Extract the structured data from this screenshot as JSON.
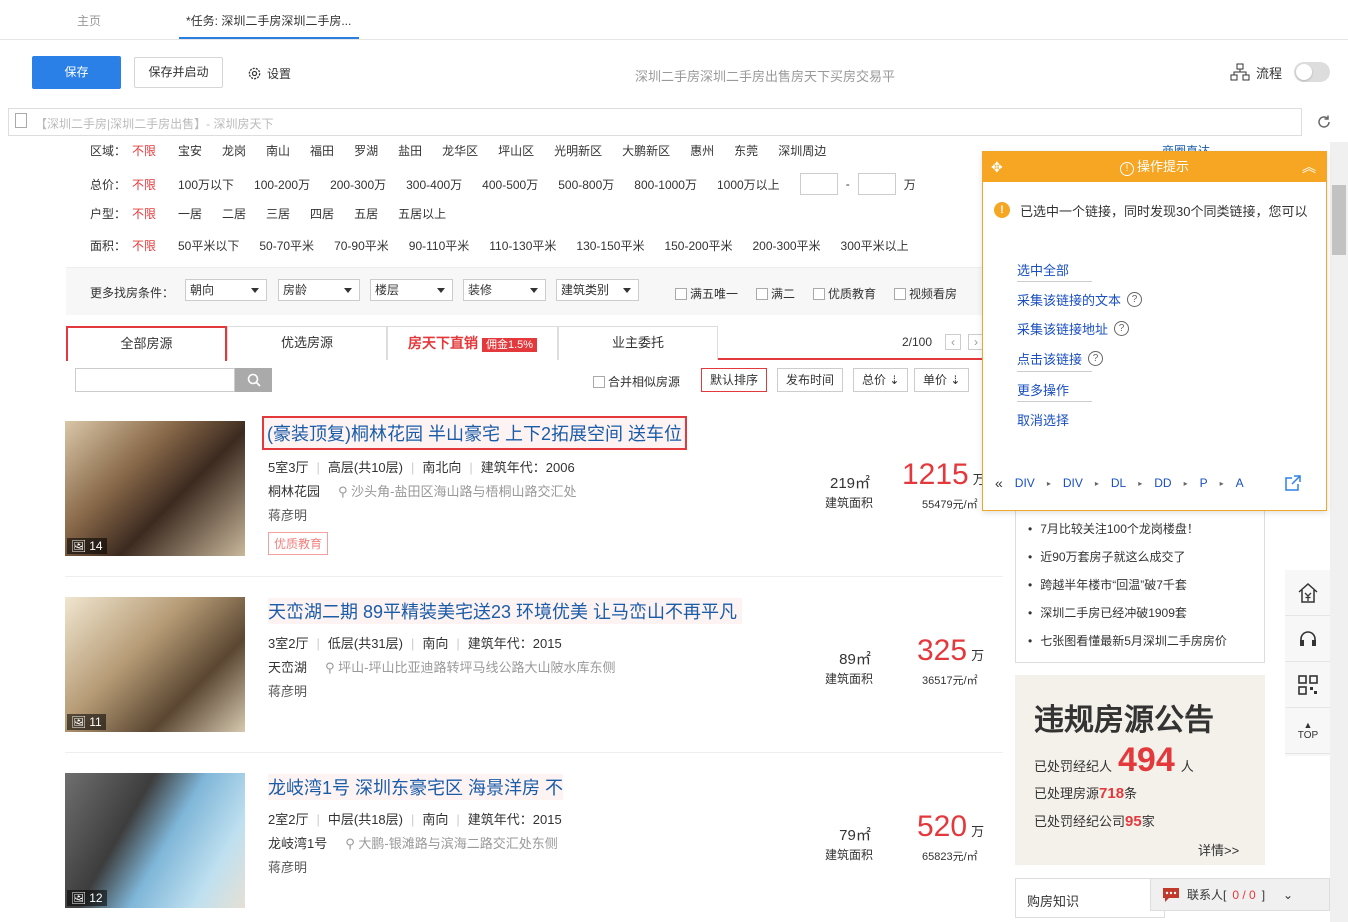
{
  "tabs": {
    "home": "主页",
    "task": "*任务: 深圳二手房深圳二手房..."
  },
  "toolbar": {
    "save": "保存",
    "save_start": "保存并启动",
    "settings": "设置",
    "title": "深圳二手房深圳二手房出售房天下买房交易平",
    "flow": "流程"
  },
  "url": {
    "text": "【深圳二手房|深圳二手房出售】- 深圳房天下"
  },
  "filters": {
    "area": {
      "label": "区域：",
      "unlimited": "不限",
      "options": [
        "宝安",
        "龙岗",
        "南山",
        "福田",
        "罗湖",
        "盐田",
        "龙华区",
        "坪山区",
        "光明新区",
        "大鹏新区",
        "惠州",
        "东莞",
        "深圳周边"
      ]
    },
    "price": {
      "label": "总价：",
      "unlimited": "不限",
      "options": [
        "100万以下",
        "100-200万",
        "200-300万",
        "300-400万",
        "400-500万",
        "500-800万",
        "800-1000万",
        "1000万以上"
      ],
      "unit": "万",
      "dash": "-"
    },
    "layout": {
      "label": "户型：",
      "unlimited": "不限",
      "options": [
        "一居",
        "二居",
        "三居",
        "四居",
        "五居",
        "五居以上"
      ]
    },
    "size": {
      "label": "面积：",
      "unlimited": "不限",
      "options": [
        "50平米以下",
        "50-70平米",
        "70-90平米",
        "90-110平米",
        "110-130平米",
        "130-150平米",
        "150-200平米",
        "200-300平米",
        "300平米以上"
      ]
    },
    "commercial": "商圈直达"
  },
  "more": {
    "label": "更多找房条件：",
    "selects": [
      "朝向",
      "房龄",
      "楼层",
      "装修",
      "建筑类别"
    ],
    "checks": [
      "满五唯一",
      "满二",
      "优质教育",
      "视频看房"
    ]
  },
  "source_tabs": {
    "all": "全部房源",
    "preferred": "优选房源",
    "direct": "房天下直销",
    "commission": "佣金1.5%",
    "owner": "业主委托",
    "pager": "2/100"
  },
  "sort": {
    "merge": "合并相似房源",
    "default": "默认排序",
    "time": "发布时间",
    "total": "总价",
    "unit": "单价"
  },
  "listings": [
    {
      "title": "(豪装顶复)桐林花园 半山豪宅 上下2拓展空间 送车位",
      "rooms": "5室3厅",
      "floor": "高层(共10层)",
      "orient": "南北向",
      "year": "建筑年代：2006",
      "community": "桐林花园",
      "address": "沙头角-盐田区海山路与梧桐山路交汇处",
      "agent": "蒋彦明",
      "tag": "优质教育",
      "area": "219㎡",
      "area_label": "建筑面积",
      "price": "1215",
      "price_unit": "万",
      "unit_price": "55479元/㎡",
      "photos": "14"
    },
    {
      "title": "天峦湖二期 89平精装美宅送23 环境优美 让马峦山不再平凡",
      "rooms": "3室2厅",
      "floor": "低层(共31层)",
      "orient": "南向",
      "year": "建筑年代：2015",
      "community": "天峦湖",
      "address": "坪山-坪山比亚迪路转坪马线公路大山陂水库东侧",
      "agent": "蒋彦明",
      "area": "89㎡",
      "area_label": "建筑面积",
      "price": "325",
      "price_unit": "万",
      "unit_price": "36517元/㎡",
      "photos": "11"
    },
    {
      "title": "龙岐湾1号 深圳东豪宅区 海景洋房 不",
      "rooms": "2室2厅",
      "floor": "中层(共18层)",
      "orient": "南向",
      "year": "建筑年代：2015",
      "community": "龙岐湾1号",
      "address": "大鹏-银滩路与滨海二路交汇处东侧",
      "agent": "蒋彦明",
      "area": "79㎡",
      "area_label": "建筑面积",
      "price": "520",
      "price_unit": "万",
      "unit_price": "65823元/㎡",
      "photos": "12"
    }
  ],
  "news": [
    "7月比较关注100个龙岗楼盘！",
    "近90万套房子就这么成交了",
    "跨越半年楼市“回温”破7千套",
    "深圳二手房已经冲破1909套",
    "七张图看懂最新5月深圳二手房房价"
  ],
  "notice": {
    "title": "违规房源公告",
    "line1a": "已处罚经纪人",
    "line1n": "494",
    "line1b": "人",
    "line2a": "已处理房源",
    "line2n": "718",
    "line2b": "条",
    "line3a": "已处罚经纪公司",
    "line3n": "95",
    "line3b": "家",
    "more": "详情>>"
  },
  "buy_know": "购房知识",
  "chat": {
    "label": "联系人[",
    "count": "0 / 0",
    "end": "]"
  },
  "side": {
    "top": "TOP"
  },
  "popup": {
    "title": "操作提示",
    "message": "已选中一个链接，同时发现30个同类链接，您可以",
    "actions": [
      "选中全部",
      "采集该链接的文本",
      "采集该链接地址",
      "点击该链接",
      "更多操作",
      "取消选择"
    ],
    "crumbs": [
      "DIV",
      "DIV",
      "DL",
      "DD",
      "P",
      "A"
    ]
  },
  "colors": {
    "accent": "#2b80e8",
    "price": "#e4393c",
    "popup": "#f6a623"
  }
}
